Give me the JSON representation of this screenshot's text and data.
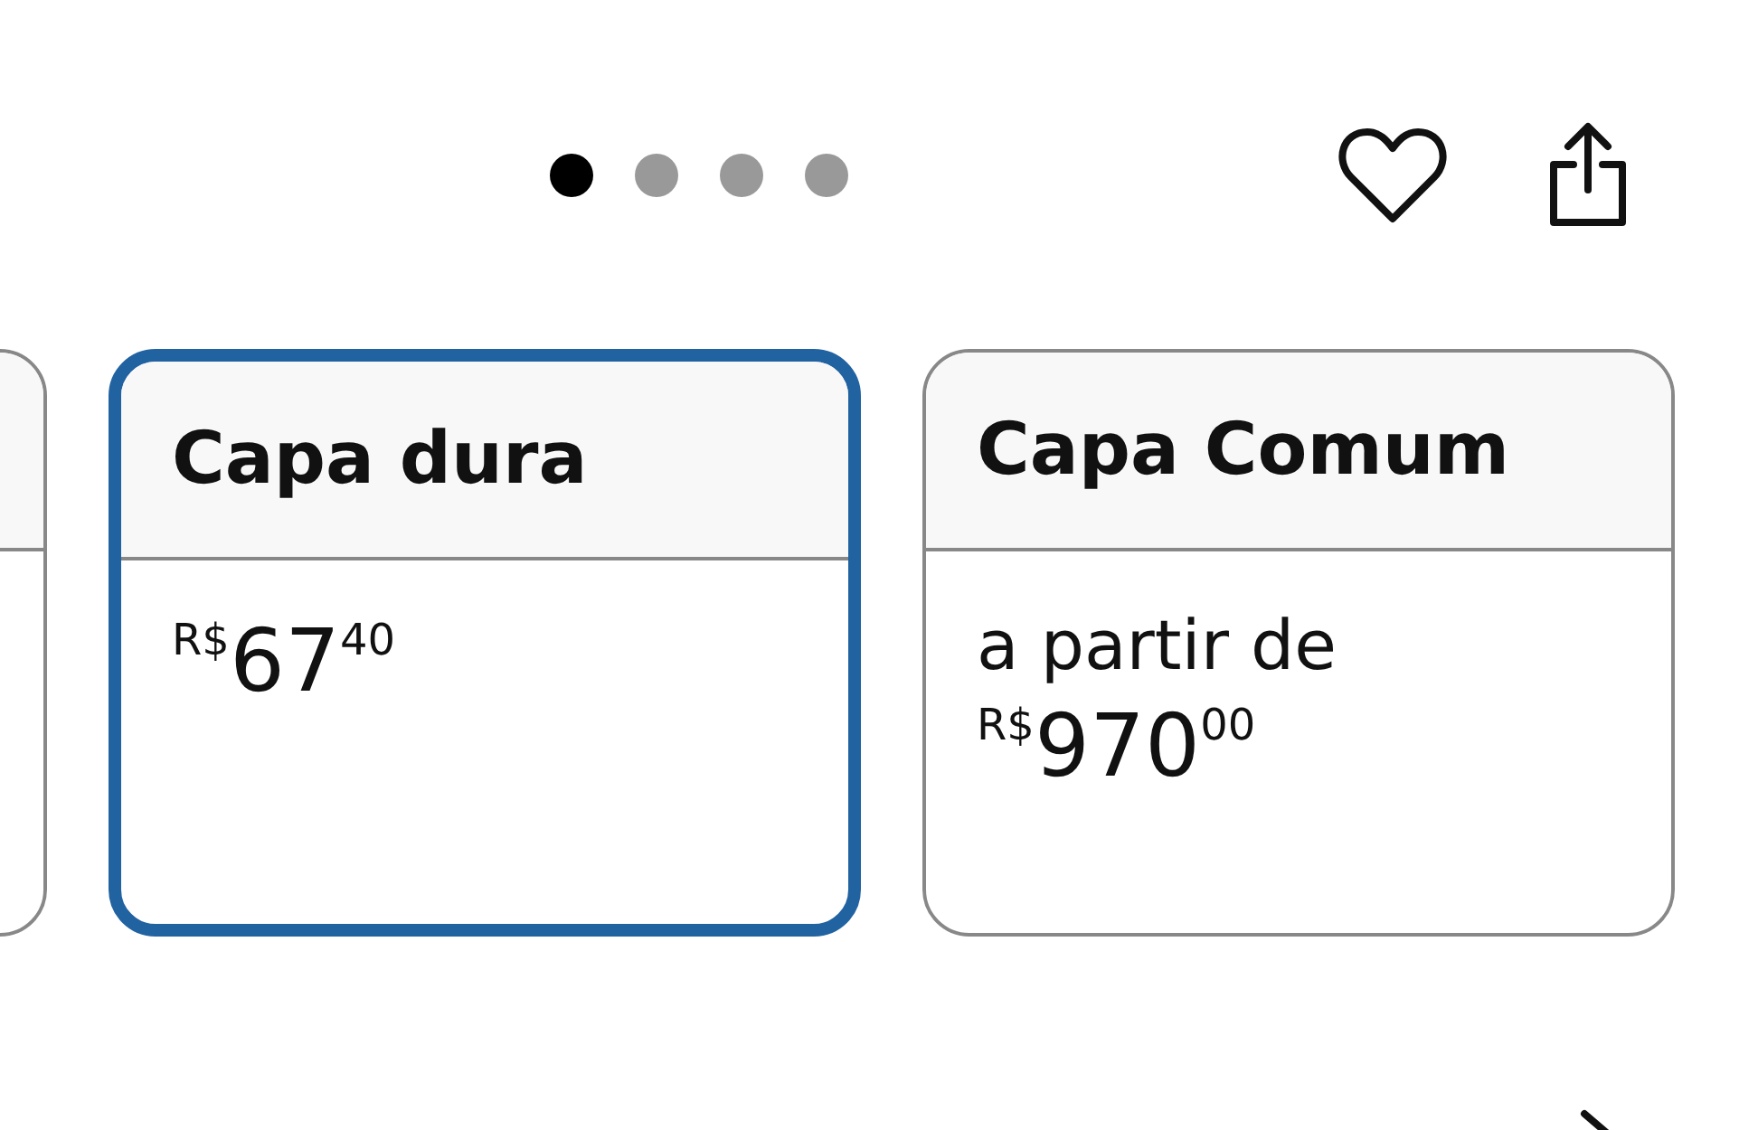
{
  "carousel_dots": [
    {
      "selected": true
    },
    {
      "selected": false
    },
    {
      "selected": false
    },
    {
      "selected": false
    }
  ],
  "formats": [
    {
      "title": "Capa dura",
      "selected": true,
      "price": {
        "currency": "R$",
        "whole": "67",
        "fraction": "40"
      }
    },
    {
      "title": "Capa Comum",
      "selected": false,
      "prefix": "a partir de",
      "price": {
        "currency": "R$",
        "whole": "970",
        "fraction": "00"
      }
    }
  ]
}
